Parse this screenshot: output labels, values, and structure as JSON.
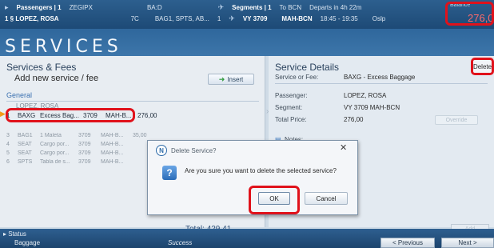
{
  "header": {
    "passengers_label": "Passengers | 1",
    "record_locator": "ZEGIPX",
    "ba_label": "BA:D",
    "segments_label": "Segments | 1",
    "to_label": "To BCN",
    "departs": "Departs in 4h 22m",
    "passenger_row": "1 § LOPEZ, ROSA",
    "pax_type": "7C",
    "pax_services": "BAG1, SPTS, AB...",
    "segment_count": "1",
    "flight": "VY 3709",
    "route": "MAH-BCN",
    "times": "18:45 - 19:35",
    "status_code": "Oslp",
    "balance_label": "Balance",
    "balance_value": "276,0"
  },
  "page_title": "SERVICES",
  "left": {
    "title": "Services & Fees",
    "add_label": "Add new service / fee",
    "insert_label": "Insert",
    "general_label": "General",
    "passenger_name": "LOPEZ, ROSA",
    "rows": [
      {
        "num": "1",
        "code": "BAXG",
        "desc": "Excess Bag...",
        "flight": "3709",
        "seg": "MAH-B...",
        "price": "276,00"
      },
      {
        "num": "3",
        "code": "BAG1",
        "desc": "1 Maleta",
        "flight": "3709",
        "seg": "MAH-B...",
        "price": "35,00"
      },
      {
        "num": "4",
        "code": "SEAT",
        "desc": "Cargo por...",
        "flight": "3709",
        "seg": "MAH-B...",
        "price": ""
      },
      {
        "num": "5",
        "code": "SEAT",
        "desc": "Cargo por...",
        "flight": "3709",
        "seg": "MAH-B...",
        "price": ""
      },
      {
        "num": "6",
        "code": "SPTS",
        "desc": "Tabla de s...",
        "flight": "3709",
        "seg": "MAH-B...",
        "price": ""
      }
    ],
    "total_label": "Total: 429,41"
  },
  "right": {
    "title": "Service Details",
    "service_fee_label": "Service or Fee:",
    "service_fee_value": "BAXG - Excess Baggage",
    "delete_label": "Delete",
    "passenger_label": "Passenger:",
    "passenger_value": "LOPEZ, ROSA",
    "segment_label": "Segment:",
    "segment_value": "VY 3709 MAH-BCN",
    "total_price_label": "Total Price:",
    "total_price_value": "276,00",
    "override_label": "Override",
    "notes_label": "Notes:",
    "add_label": "Add"
  },
  "dialog": {
    "title": "Delete Service?",
    "logo_letter": "N",
    "message": "Are you sure you want to delete the selected service?",
    "ok_label": "OK",
    "cancel_label": "Cancel"
  },
  "status": {
    "tab_label": "Status",
    "left_text": "Baggage",
    "mid_text": "Success",
    "previous_label": "< Previous",
    "next_label": "Next >"
  },
  "colors": {
    "highlight_red": "#e0121b",
    "header_blue": "#1d4a76",
    "balance_text": "#ff6a6a"
  }
}
